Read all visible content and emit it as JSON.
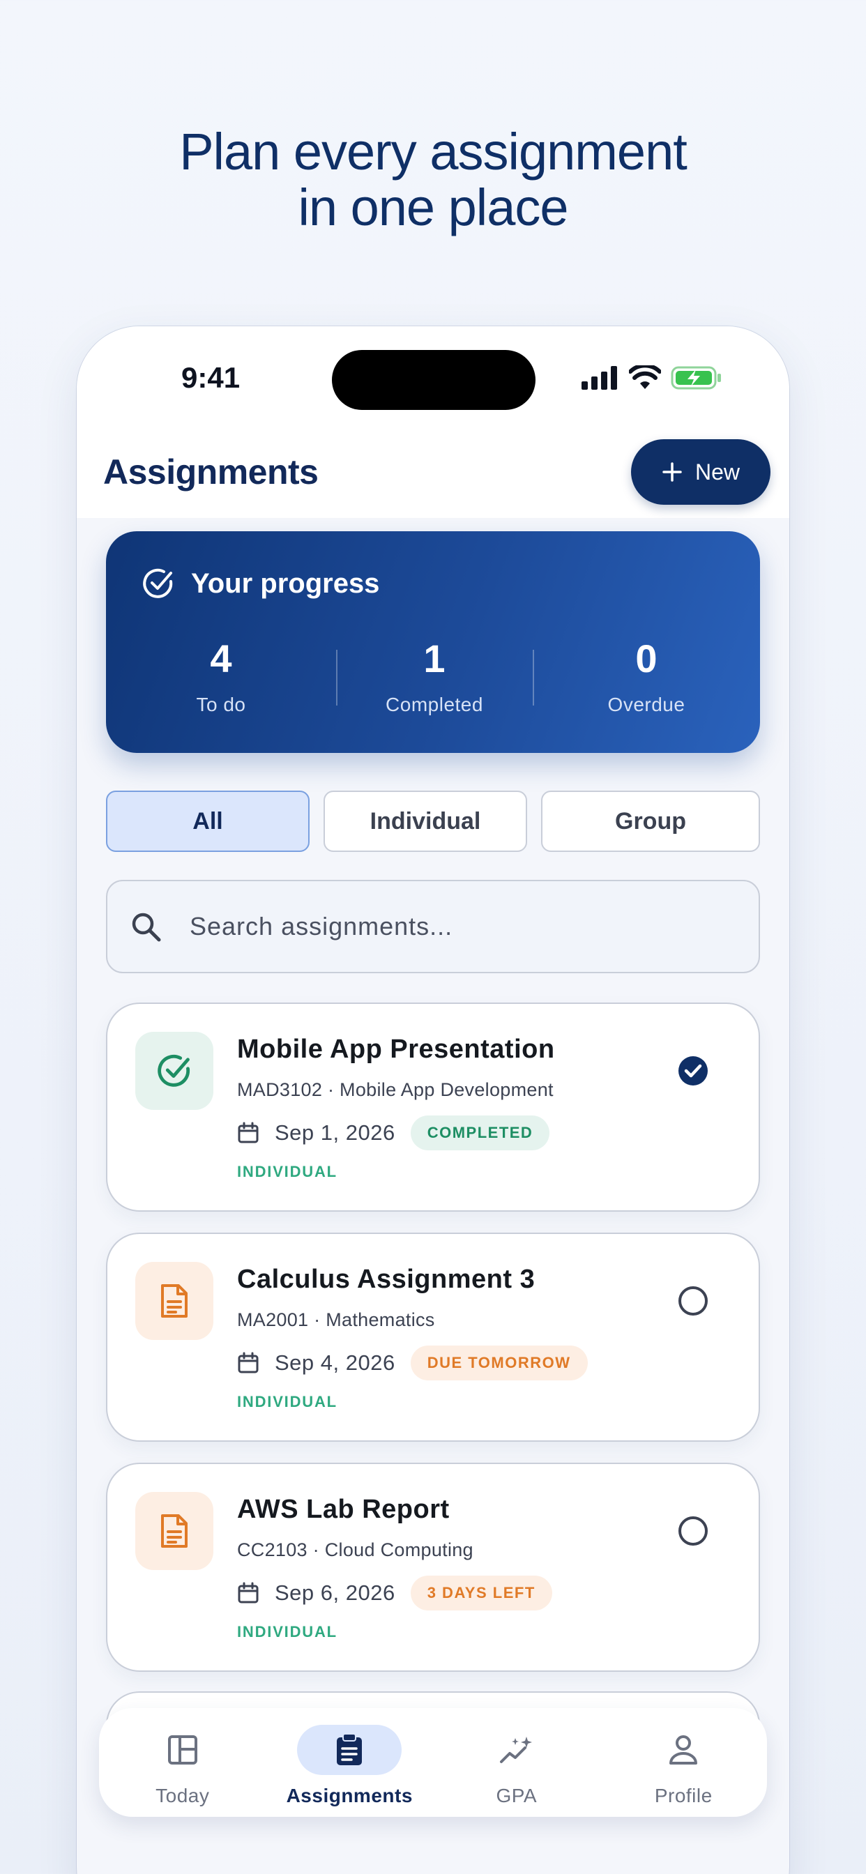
{
  "headline": {
    "line1": "Plan every assignment",
    "line2": "in one place"
  },
  "status_bar": {
    "time": "9:41"
  },
  "header": {
    "title": "Assignments",
    "new_label": "New"
  },
  "progress": {
    "title": "Your progress",
    "stats": [
      {
        "value": "4",
        "label": "To do"
      },
      {
        "value": "1",
        "label": "Completed"
      },
      {
        "value": "0",
        "label": "Overdue"
      }
    ]
  },
  "filters": {
    "all": "All",
    "individual": "Individual",
    "group": "Group",
    "selected": "All"
  },
  "search": {
    "placeholder": "Search assignments..."
  },
  "assignments": [
    {
      "title": "Mobile App Presentation",
      "course": "MAD3102 · Mobile App Development",
      "date": "Sep 1, 2026",
      "status": "COMPLETED",
      "type": "INDIVIDUAL",
      "done": true
    },
    {
      "title": "Calculus Assignment 3",
      "course": "MA2001 · Mathematics",
      "date": "Sep 4, 2026",
      "status": "DUE TOMORROW",
      "type": "INDIVIDUAL",
      "done": false
    },
    {
      "title": "AWS Lab Report",
      "course": "CC2103 · Cloud Computing",
      "date": "Sep 6, 2026",
      "status": "3 DAYS LEFT",
      "type": "INDIVIDUAL",
      "done": false
    }
  ],
  "tabs": {
    "today": "Today",
    "assignments": "Assignments",
    "gpa": "GPA",
    "profile": "Profile",
    "active": "Assignments"
  },
  "colors": {
    "primary": "#0f2f66",
    "accent_blue": "#2a62bc",
    "green": "#1d8e63",
    "orange": "#e07a27",
    "teal": "#2fa980"
  }
}
